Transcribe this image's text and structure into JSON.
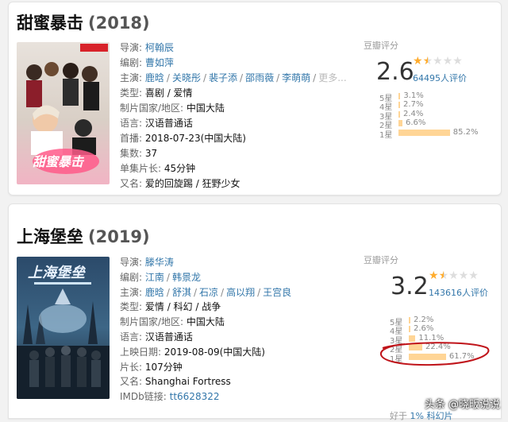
{
  "movies": [
    {
      "title": "甜蜜暴击",
      "year": "(2018)",
      "info": {
        "director_k": "导演:",
        "director": "柯翰辰",
        "writer_k": "编剧:",
        "writer": "曹如萍",
        "cast_k": "主演:",
        "cast": [
          "鹿晗",
          "关晓彤",
          "裴子添",
          "邵雨薇",
          "李萌萌"
        ],
        "cast_more": "更多...",
        "genre_k": "类型:",
        "genre": "喜剧 / 爱情",
        "country_k": "制片国家/地区:",
        "country": "中国大陆",
        "lang_k": "语言:",
        "lang": "汉语普通话",
        "release_k": "首播:",
        "release": "2018-07-23(中国大陆)",
        "episodes_k": "集数:",
        "episodes": "37",
        "runtime_k": "单集片长:",
        "runtime": "45分钟",
        "aka_k": "又名:",
        "aka": "爱的回旋踢 / 狂野少女"
      },
      "rating": {
        "label": "豆瓣评分",
        "score": "2.6",
        "stars": 1.5,
        "votes": "64495人评价",
        "dist": [
          {
            "star": "5星",
            "pct": "3.1%",
            "value": 3.1
          },
          {
            "star": "4星",
            "pct": "2.7%",
            "value": 2.7
          },
          {
            "star": "3星",
            "pct": "2.4%",
            "value": 2.4
          },
          {
            "star": "2星",
            "pct": "6.6%",
            "value": 6.6
          },
          {
            "star": "1星",
            "pct": "85.2%",
            "value": 85.2
          }
        ]
      }
    },
    {
      "title": "上海堡垒",
      "year": "(2019)",
      "info": {
        "director_k": "导演:",
        "director": "滕华涛",
        "writer_k": "编剧:",
        "writer": [
          "江南",
          "韩景龙"
        ],
        "cast_k": "主演:",
        "cast": [
          "鹿晗",
          "舒淇",
          "石凉",
          "高以翔",
          "王宫良"
        ],
        "genre_k": "类型:",
        "genre": "爱情 / 科幻 / 战争",
        "country_k": "制片国家/地区:",
        "country": "中国大陆",
        "lang_k": "语言:",
        "lang": "汉语普通话",
        "release_k": "上映日期:",
        "release": "2019-08-09(中国大陆)",
        "runtime_k": "片长:",
        "runtime": "107分钟",
        "aka_k": "又名:",
        "aka": "Shanghai Fortress",
        "imdb_k": "IMDb链接:",
        "imdb": "tt6628322"
      },
      "rating": {
        "label": "豆瓣评分",
        "score": "3.2",
        "stars": 1.5,
        "votes": "143616人评价",
        "dist": [
          {
            "star": "5星",
            "pct": "2.2%",
            "value": 2.2
          },
          {
            "star": "4星",
            "pct": "2.6%",
            "value": 2.6
          },
          {
            "star": "3星",
            "pct": "11.1%",
            "value": 11.1
          },
          {
            "star": "2星",
            "pct": "22.4%",
            "value": 22.4
          },
          {
            "star": "1星",
            "pct": "61.7%",
            "value": 61.7
          }
        ],
        "better_than_prefix": "好于",
        "better_than_pct": "1%",
        "better_than_genre": "科幻片",
        "better_than_prefix2": "好于"
      }
    }
  ],
  "watermark": "头条 @晓畈说说",
  "colors": {
    "link": "#3377aa",
    "star": "#ffac2d",
    "bar": "#ffd596",
    "annotation": "#c0141a"
  }
}
